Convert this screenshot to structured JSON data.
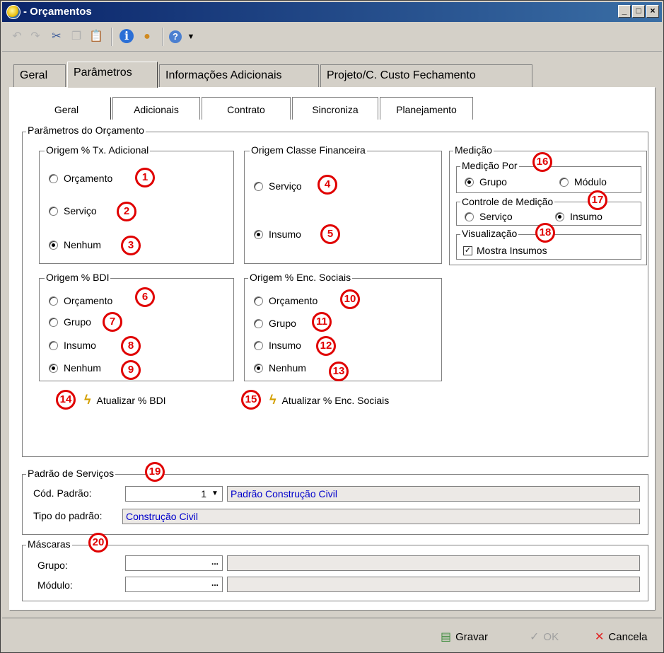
{
  "window": {
    "title": "- Orçamentos"
  },
  "tabs_main": [
    {
      "label": "Geral"
    },
    {
      "label": "Parâmetros"
    },
    {
      "label": "Informações Adicionais"
    },
    {
      "label": "Projeto/C. Custo Fechamento"
    }
  ],
  "tabs_sub": [
    {
      "label": "Geral"
    },
    {
      "label": "Adicionais"
    },
    {
      "label": "Contrato"
    },
    {
      "label": "Sincroniza"
    },
    {
      "label": "Planejamento"
    }
  ],
  "params": {
    "legend": "Parâmetros do Orçamento",
    "tx_adicional": {
      "legend": "Origem % Tx. Adicional",
      "options": [
        "Orçamento",
        "Serviço",
        "Nenhum"
      ],
      "selected": "Nenhum"
    },
    "classe_fin": {
      "legend": "Origem Classe Financeira",
      "options": [
        "Serviço",
        "Insumo"
      ],
      "selected": "Insumo"
    },
    "bdi": {
      "legend": "Origem % BDI",
      "options": [
        "Orçamento",
        "Grupo",
        "Insumo",
        "Nenhum"
      ],
      "selected": "Nenhum"
    },
    "enc_sociais": {
      "legend": "Origem % Enc. Sociais",
      "options": [
        "Orçamento",
        "Grupo",
        "Insumo",
        "Nenhum"
      ],
      "selected": "Nenhum"
    },
    "medicao": {
      "legend": "Medição",
      "por": {
        "legend": "Medição Por",
        "options": [
          "Grupo",
          "Módulo"
        ],
        "selected": "Grupo"
      },
      "controle": {
        "legend": "Controle de Medição",
        "options": [
          "Serviço",
          "Insumo"
        ],
        "selected": "Insumo"
      },
      "visualizacao": {
        "legend": "Visualização",
        "checkbox_label": "Mostra Insumos",
        "checked": true
      }
    },
    "atualizar_bdi": "Atualizar % BDI",
    "atualizar_enc": "Atualizar % Enc. Sociais"
  },
  "padrao": {
    "legend": "Padrão de Serviços",
    "cod_label": "Cód. Padrão:",
    "cod_value": "1",
    "cod_desc": "Padrão Construção Civil",
    "tipo_label": "Tipo do padrão:",
    "tipo_value": "Construção Civil"
  },
  "mascaras": {
    "legend": "Máscaras",
    "grupo_label": "Grupo:",
    "modulo_label": "Módulo:",
    "ellipsis": "..."
  },
  "badges": [
    "1",
    "2",
    "3",
    "4",
    "5",
    "6",
    "7",
    "8",
    "9",
    "10",
    "11",
    "12",
    "13",
    "14",
    "15",
    "16",
    "17",
    "18",
    "19",
    "20"
  ],
  "footer": {
    "gravar": "Gravar",
    "ok": "OK",
    "cancela": "Cancela"
  },
  "colors": {
    "title_bar": "#0a246a",
    "badge": "#e00000",
    "readonly_text": "#0000cc"
  }
}
